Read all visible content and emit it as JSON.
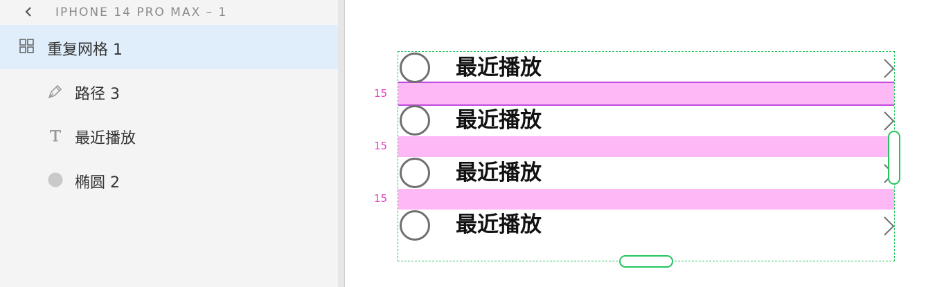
{
  "panel": {
    "back_icon": "chevron-left-icon",
    "artboard_title": "IPHONE 14 PRO MAX – 1",
    "layers": [
      {
        "label": "重复网格 1",
        "icon": "repeat-grid-icon",
        "selected": true
      },
      {
        "label": "路径 3",
        "icon": "pen-path-icon",
        "selected": false
      },
      {
        "label": "最近播放",
        "icon": "text-icon",
        "selected": false
      },
      {
        "label": "椭圆 2",
        "icon": "ellipse-icon",
        "selected": false
      }
    ]
  },
  "canvas": {
    "gap_labels": [
      "15",
      "15",
      "15"
    ],
    "cells": [
      {
        "title": "最近播放",
        "icon": "circle-icon",
        "chevron": "chevron-right-icon"
      },
      {
        "title": "最近播放",
        "icon": "circle-icon",
        "chevron": "chevron-right-icon"
      },
      {
        "title": "最近播放",
        "icon": "circle-icon",
        "chevron": "chevron-right-icon"
      },
      {
        "title": "最近播放",
        "icon": "circle-icon",
        "chevron": "chevron-right-icon"
      }
    ]
  },
  "colors": {
    "selection_highlight": "#dfeefa",
    "grid_bounds": "#22c55e",
    "gap_fill": "#ffb8f6",
    "gap_label": "#e43fc4"
  }
}
